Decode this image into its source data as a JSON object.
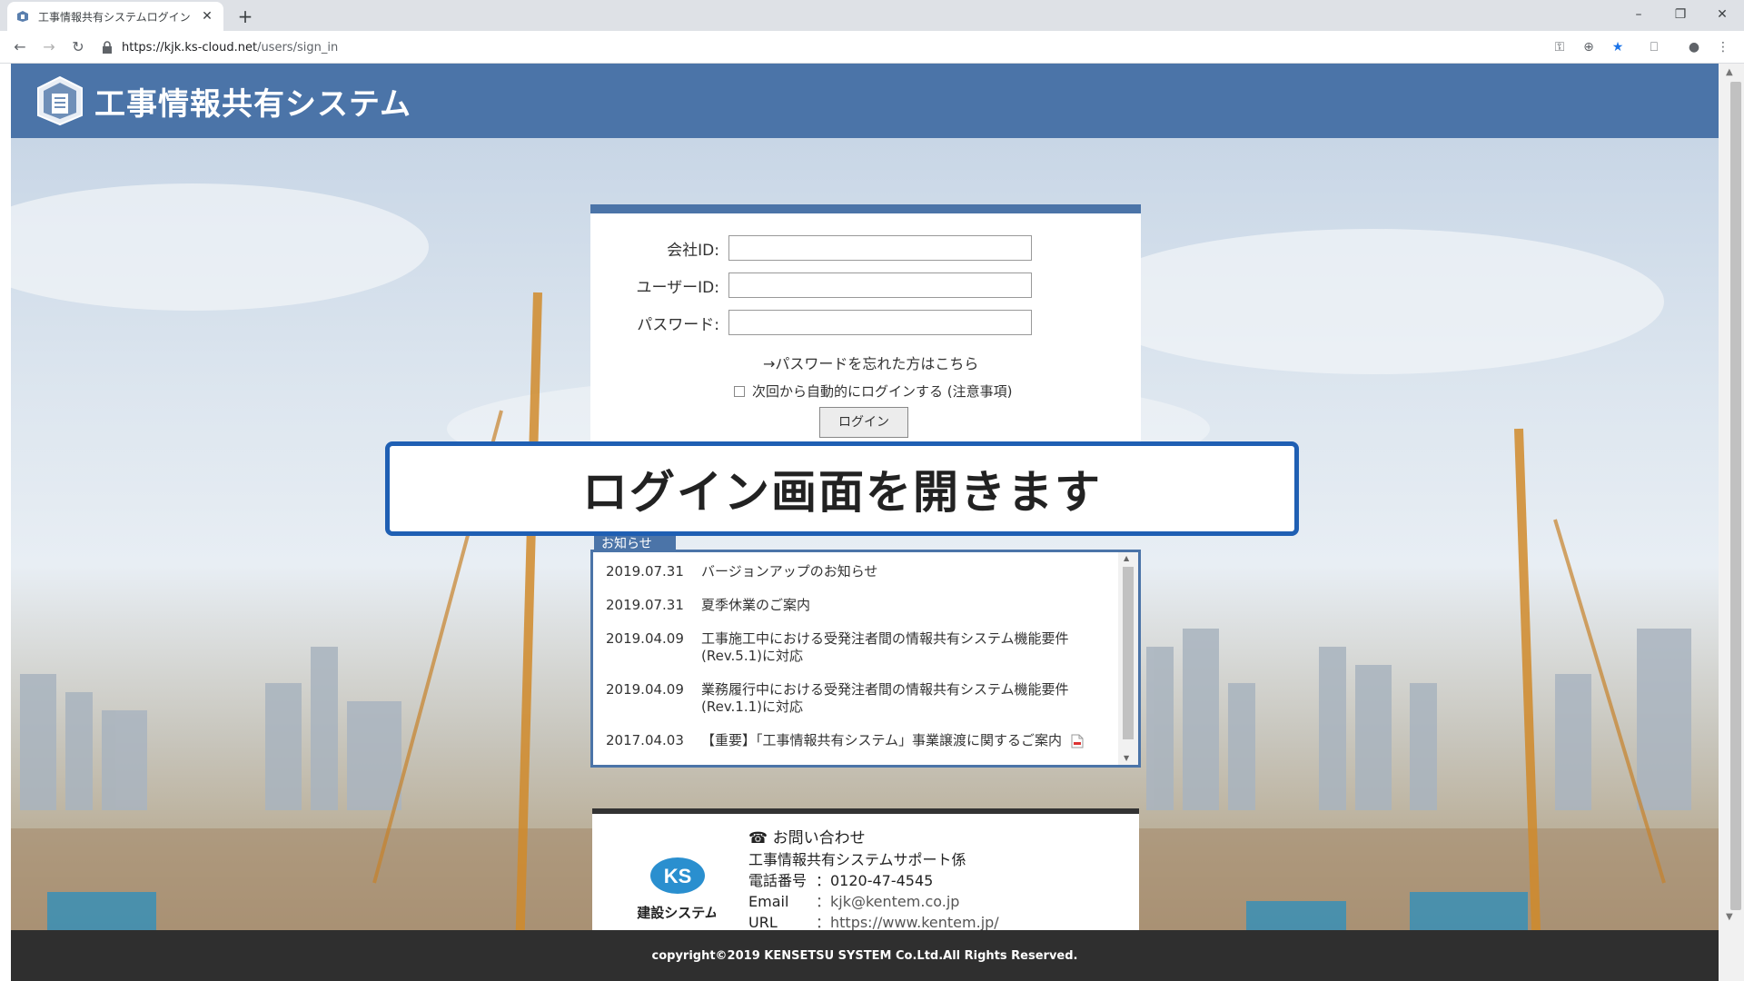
{
  "browser": {
    "tab_title": "工事情報共有システムログイン",
    "url_host": "https://kjk.ks-cloud.net",
    "url_path": "/users/sign_in"
  },
  "header": {
    "title": "工事情報共有システム"
  },
  "login": {
    "company_label": "会社ID:",
    "user_label": "ユーザーID:",
    "password_label": "パスワード:",
    "company_value": "",
    "user_value": "",
    "password_value": "",
    "forgot_link": "→パスワードを忘れた方はこちら",
    "remember_label": "次回から自動的にログインする (注意事項)",
    "login_button": "ログイン"
  },
  "banner": {
    "text": "ログイン画面を開きます"
  },
  "news": {
    "tab_label": "お知らせ",
    "items": [
      {
        "date": "2019.07.31",
        "text": "バージョンアップのお知らせ"
      },
      {
        "date": "2019.07.31",
        "text": "夏季休業のご案内"
      },
      {
        "date": "2019.04.09",
        "text": "工事施工中における受発注者間の情報共有システム機能要件(Rev.5.1)に対応"
      },
      {
        "date": "2019.04.09",
        "text": "業務履行中における受発注者間の情報共有システム機能要件(Rev.1.1)に対応"
      },
      {
        "date": "2017.04.03",
        "text": "【重要】「工事情報共有システム」事業譲渡に関するご案内"
      }
    ]
  },
  "contact": {
    "heading": "お問い合わせ",
    "org": "工事情報共有システムサポート係",
    "phone_key": "電話番号",
    "phone": "：0120-47-4545",
    "email_key": "Email",
    "email": "：kjk@kentem.co.jp",
    "url_key": "URL",
    "url": "：https://www.kentem.jp/",
    "logo_text": "建設システム"
  },
  "footer": {
    "copyright": "copyright©2019 KENSETSU SYSTEM Co.Ltd.All Rights Reserved."
  },
  "colors": {
    "header_blue": "#4b74a8",
    "banner_border": "#1f5fb3",
    "footer_dark": "#2f2f2f",
    "bookmark_star": "#1a73e8"
  }
}
